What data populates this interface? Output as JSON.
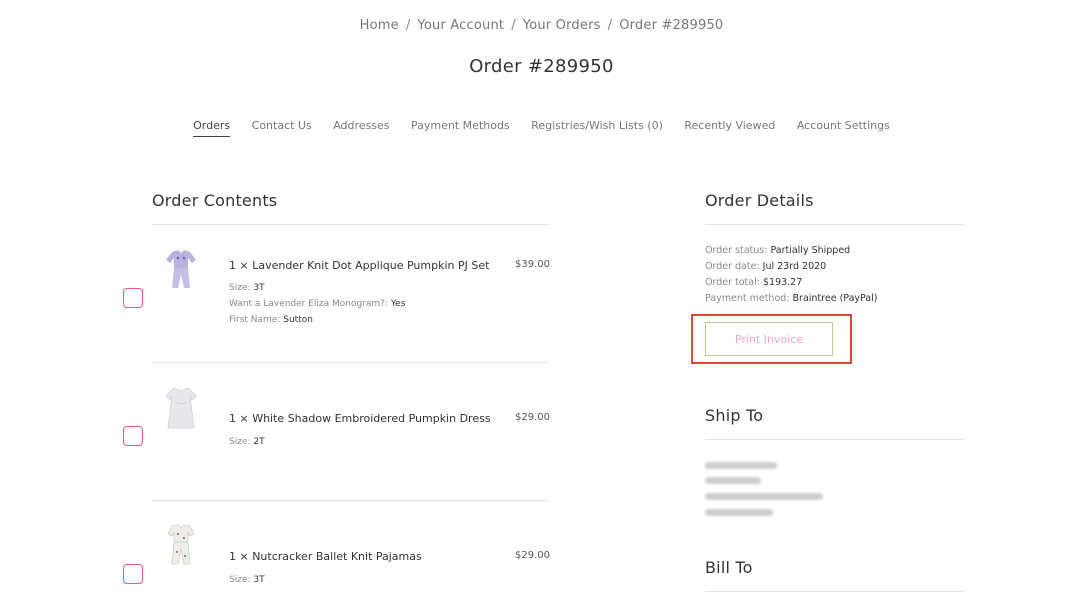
{
  "breadcrumb": {
    "items": [
      "Home",
      "Your Account",
      "Your Orders",
      "Order #289950"
    ],
    "separator": "/"
  },
  "page_title": "Order #289950",
  "account_nav": [
    {
      "label": "Orders",
      "active": true
    },
    {
      "label": "Contact Us"
    },
    {
      "label": "Addresses"
    },
    {
      "label": "Payment Methods"
    },
    {
      "label": "Registries/Wish Lists (0)"
    },
    {
      "label": "Recently Viewed"
    },
    {
      "label": "Account Settings"
    }
  ],
  "order_contents": {
    "title": "Order Contents",
    "items": [
      {
        "name": "1 × Lavender Knit Dot Applique Pumpkin PJ Set",
        "price": "$39.00",
        "options": [
          {
            "label": "Size:",
            "value": "3T"
          },
          {
            "label": "Want a Lavender Eliza Monogram?:",
            "value": "Yes"
          },
          {
            "label": "First Name:",
            "value": "Sutton"
          }
        ]
      },
      {
        "name": "1 × White Shadow Embroidered Pumpkin Dress",
        "price": "$29.00",
        "options": [
          {
            "label": "Size:",
            "value": "2T"
          }
        ]
      },
      {
        "name": "1 × Nutcracker Ballet Knit Pajamas",
        "price": "$29.00",
        "options": [
          {
            "label": "Size:",
            "value": "3T"
          }
        ]
      }
    ]
  },
  "order_details": {
    "title": "Order Details",
    "rows": [
      {
        "label": "Order status:",
        "value": "Partially Shipped"
      },
      {
        "label": "Order date:",
        "value": "Jul 23rd 2020"
      },
      {
        "label": "Order total:",
        "value": "$193.27"
      },
      {
        "label": "Payment method:",
        "value": "Braintree (PayPal)"
      }
    ],
    "print_button": "Print Invoice"
  },
  "ship_to": {
    "title": "Ship To"
  },
  "bill_to": {
    "title": "Bill To"
  },
  "colors": {
    "checkbox_border": "#e0548f",
    "print_button_border": "#b7cf8c",
    "print_button_text": "#f0a9c2",
    "highlight_box": "#d34a36"
  }
}
